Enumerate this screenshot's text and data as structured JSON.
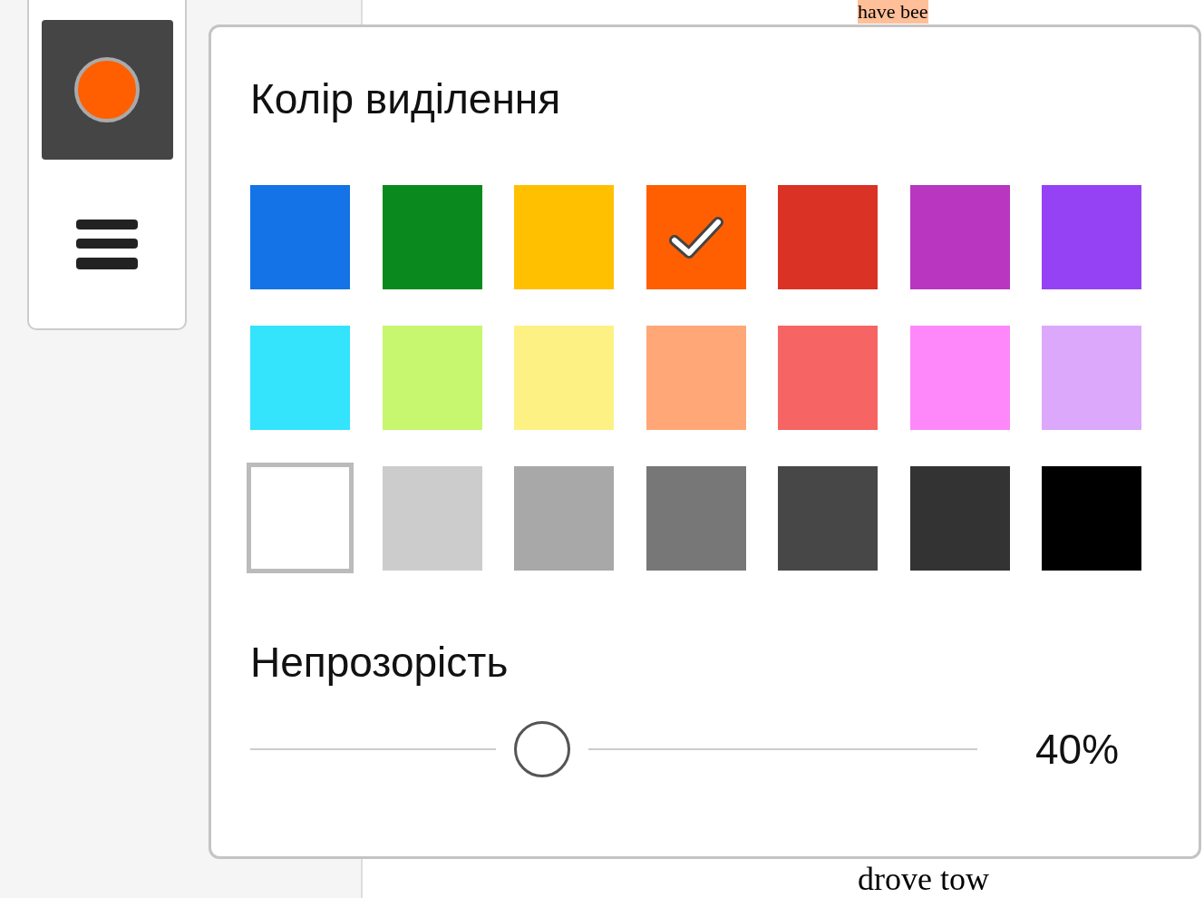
{
  "toolbar": {
    "highlight_button": {
      "selected": true
    }
  },
  "document": {
    "lines": [
      {
        "text": "have bee",
        "highlighted": true
      },
      {
        "text": "drove tow",
        "highlighted": false
      }
    ]
  },
  "popup": {
    "title": "Колір виділення",
    "swatches": [
      {
        "color": "#1473e6",
        "selected": false
      },
      {
        "color": "#0a8a1e",
        "selected": false
      },
      {
        "color": "#ffc000",
        "selected": false
      },
      {
        "color": "#ff5f00",
        "selected": true
      },
      {
        "color": "#db3226",
        "selected": false
      },
      {
        "color": "#b936c0",
        "selected": false
      },
      {
        "color": "#9542f5",
        "selected": false
      },
      {
        "color": "#34e3fc",
        "selected": false
      },
      {
        "color": "#c6f76e",
        "selected": false
      },
      {
        "color": "#fef183",
        "selected": false
      },
      {
        "color": "#ffa776",
        "selected": false
      },
      {
        "color": "#f76464",
        "selected": false
      },
      {
        "color": "#fe88f9",
        "selected": false
      },
      {
        "color": "#dca8fc",
        "selected": false
      },
      {
        "color": "#ffffff",
        "selected": false
      },
      {
        "color": "#cccccc",
        "selected": false
      },
      {
        "color": "#a8a8a8",
        "selected": false
      },
      {
        "color": "#777777",
        "selected": false
      },
      {
        "color": "#474747",
        "selected": false
      },
      {
        "color": "#333333",
        "selected": false
      },
      {
        "color": "#000000",
        "selected": false
      }
    ],
    "opacity_label": "Непрозорість",
    "level": 0.4,
    "reading": "40%"
  }
}
